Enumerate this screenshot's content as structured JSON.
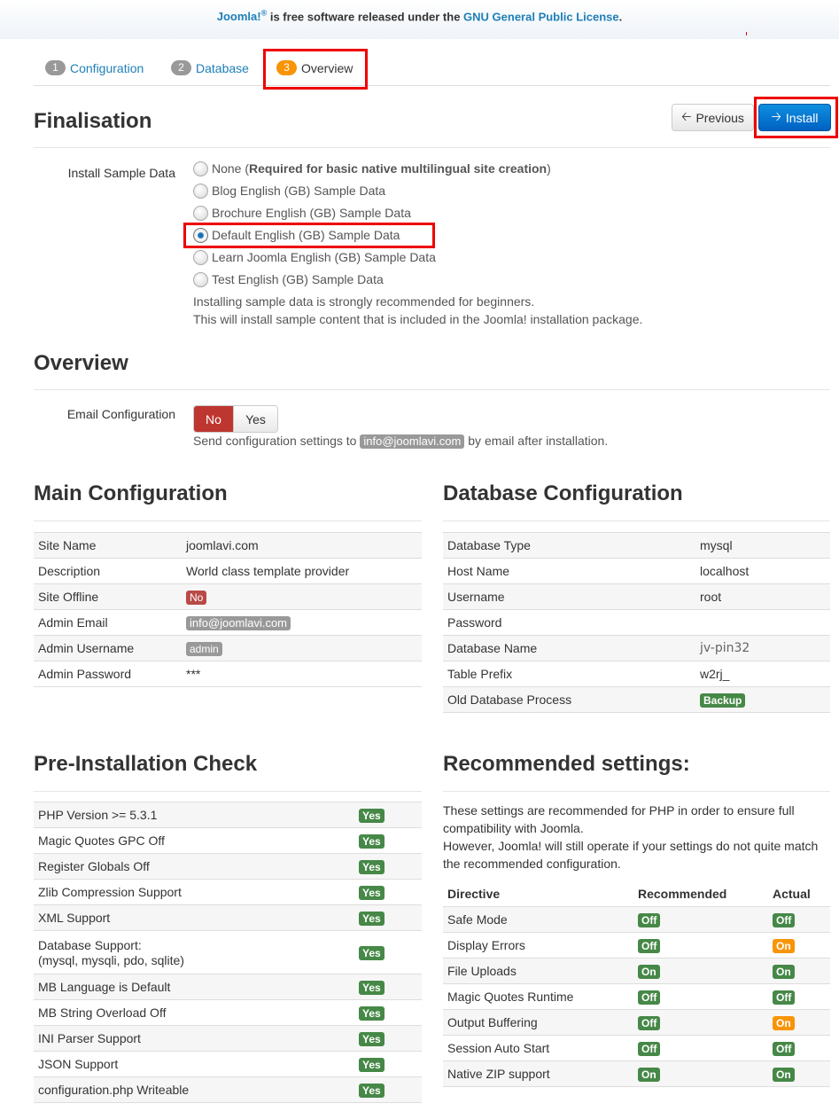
{
  "header": {
    "brand": "Joomla!",
    "brand_sup": "®",
    "text_mid": " is free software released under the ",
    "license": "GNU General Public License",
    "text_end": "."
  },
  "tabs": [
    {
      "num": "1",
      "label": "Configuration"
    },
    {
      "num": "2",
      "label": "Database"
    },
    {
      "num": "3",
      "label": "Overview"
    }
  ],
  "finalisation": {
    "title": "Finalisation",
    "previous_label": "Previous",
    "install_label": "Install",
    "sample_label": "Install Sample Data",
    "options": [
      {
        "text": "None (",
        "bold": "Required for basic native multilingual site creation",
        "after": ")"
      },
      {
        "text": "Blog English (GB) Sample Data"
      },
      {
        "text": "Brochure English (GB) Sample Data"
      },
      {
        "text": "Default English (GB) Sample Data"
      },
      {
        "text": "Learn Joomla English (GB) Sample Data"
      },
      {
        "text": "Test English (GB) Sample Data"
      }
    ],
    "selected_index": 3,
    "help1": "Installing sample data is strongly recommended for beginners.",
    "help2": "This will install sample content that is included in the Joomla! installation package."
  },
  "overview": {
    "title": "Overview",
    "email_label": "Email Configuration",
    "no_label": "No",
    "yes_label": "Yes",
    "send_pre": "Send configuration settings to",
    "send_email": "info@joomlavi.com",
    "send_post": "by email after installation."
  },
  "main_config": {
    "title": "Main Configuration",
    "rows": [
      {
        "label": "Site Name",
        "value": "joomlavi.com"
      },
      {
        "label": "Description",
        "value": "World class template provider"
      },
      {
        "label": "Site Offline",
        "value": "No"
      },
      {
        "label": "Admin Email",
        "value": "info@joomlavi.com"
      },
      {
        "label": "Admin Username",
        "value": "admin"
      },
      {
        "label": "Admin Password",
        "value": "***"
      }
    ]
  },
  "db_config": {
    "title": "Database Configuration",
    "rows": [
      {
        "label": "Database Type",
        "value": "mysql"
      },
      {
        "label": "Host Name",
        "value": "localhost"
      },
      {
        "label": "Username",
        "value": "root"
      },
      {
        "label": "Password",
        "value": ""
      },
      {
        "label": "Database Name",
        "value": "jv-pin32"
      },
      {
        "label": "Table Prefix",
        "value": "w2rj_"
      },
      {
        "label": "Old Database Process",
        "value": "Backup"
      }
    ]
  },
  "precheck": {
    "title": "Pre-Installation Check",
    "rows": [
      {
        "label": "PHP Version >= 5.3.1",
        "value": "Yes"
      },
      {
        "label": "Magic Quotes GPC Off",
        "value": "Yes"
      },
      {
        "label": "Register Globals Off",
        "value": "Yes"
      },
      {
        "label": "Zlib Compression Support",
        "value": "Yes"
      },
      {
        "label": "XML Support",
        "value": "Yes"
      },
      {
        "label": "Database Support:",
        "sub": "(mysql, mysqli, pdo, sqlite)",
        "value": "Yes"
      },
      {
        "label": "MB Language is Default",
        "value": "Yes"
      },
      {
        "label": "MB String Overload Off",
        "value": "Yes"
      },
      {
        "label": "INI Parser Support",
        "value": "Yes"
      },
      {
        "label": "JSON Support",
        "value": "Yes"
      },
      {
        "label": "configuration.php Writeable",
        "value": "Yes"
      }
    ]
  },
  "recommended": {
    "title": "Recommended settings:",
    "text1": "These settings are recommended for PHP in order to ensure full compatibility with Joomla.",
    "text2": "However, Joomla! will still operate if your settings do not quite match the recommended configuration.",
    "headers": [
      "Directive",
      "Recommended",
      "Actual"
    ],
    "rows": [
      {
        "directive": "Safe Mode",
        "recommended": "Off",
        "actual": "Off",
        "ok": true
      },
      {
        "directive": "Display Errors",
        "recommended": "Off",
        "actual": "On",
        "ok": false
      },
      {
        "directive": "File Uploads",
        "recommended": "On",
        "actual": "On",
        "ok": true
      },
      {
        "directive": "Magic Quotes Runtime",
        "recommended": "Off",
        "actual": "Off",
        "ok": true
      },
      {
        "directive": "Output Buffering",
        "recommended": "Off",
        "actual": "On",
        "ok": false
      },
      {
        "directive": "Session Auto Start",
        "recommended": "Off",
        "actual": "Off",
        "ok": true
      },
      {
        "directive": "Native ZIP support",
        "recommended": "On",
        "actual": "On",
        "ok": true
      }
    ]
  },
  "colors": {
    "link": "#1e7fb8",
    "success": "#468847",
    "warning": "#f89406",
    "danger": "#b94a48",
    "primary": "#0061c2",
    "highlight": "#e00000"
  }
}
